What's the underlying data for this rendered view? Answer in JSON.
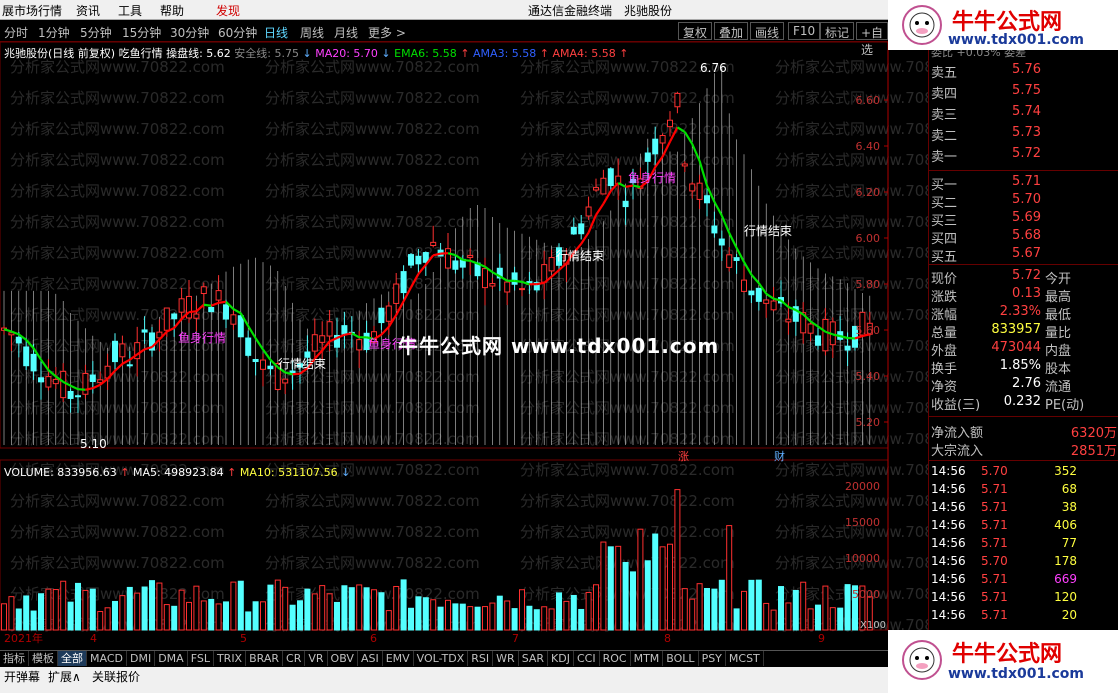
{
  "menu": {
    "items": [
      "展市场行情",
      "资讯",
      "工具",
      "帮助",
      "发现"
    ],
    "title": "通达信金融终端",
    "stock": "兆驰股份"
  },
  "periods": [
    "分时",
    "1分钟",
    "5分钟",
    "15分钟",
    "30分钟",
    "60分钟",
    "日线",
    "周线",
    "月线",
    "更多 >"
  ],
  "period_active": "日线",
  "toolbar_buttons": [
    "复权",
    "叠加",
    "画线",
    "F10",
    "标记",
    "+自选"
  ],
  "legend_main": {
    "name": "兆驰股份(日线 前复权) 吃鱼行情",
    "czx": "操盘线: 5.62",
    "aqx": "安全线: 5.75",
    "ma20": "MA20: 5.70",
    "ema6": "EMA6: 5.58",
    "ama3": "AMA3: 5.58",
    "ama4": "AMA4: 5.58"
  },
  "legend_volume": {
    "vol": "VOLUME: 833956.63",
    "ma5": "MA5: 498923.84",
    "ma10": "MA10: 531107.56"
  },
  "annotations": {
    "high": "6.76",
    "low": "5.10",
    "fish": "鱼身行情",
    "end": "行情结束",
    "year": "2021年",
    "up": "涨",
    "cai": "财",
    "x100": "X100"
  },
  "month_labels": [
    "4",
    "5",
    "6",
    "7",
    "8",
    "9"
  ],
  "price_axis": [
    "6.60",
    "6.40",
    "6.20",
    "6.00",
    "5.80",
    "5.60",
    "5.40",
    "5.20"
  ],
  "vol_axis": [
    "20000",
    "15000",
    "10000",
    "5000"
  ],
  "watermark": "分析家公式网www.70822.com",
  "overlay": "牛牛公式网 www.tdx001.com",
  "logo": {
    "cn": "牛牛公式网",
    "url": "www.tdx001.com"
  },
  "quote": {
    "header": "委比 +0.03% 委差",
    "sells": [
      {
        "label": "卖五",
        "price": "5.76"
      },
      {
        "label": "卖四",
        "price": "5.75"
      },
      {
        "label": "卖三",
        "price": "5.74"
      },
      {
        "label": "卖二",
        "price": "5.73"
      },
      {
        "label": "卖一",
        "price": "5.72"
      }
    ],
    "buys": [
      {
        "label": "买一",
        "price": "5.71"
      },
      {
        "label": "买二",
        "price": "5.70"
      },
      {
        "label": "买三",
        "price": "5.69"
      },
      {
        "label": "买四",
        "price": "5.68"
      },
      {
        "label": "买五",
        "price": "5.67"
      }
    ],
    "stats": [
      {
        "label": "现价",
        "value": "5.72",
        "right": "今开"
      },
      {
        "label": "涨跌",
        "value": "0.13",
        "right": "最高"
      },
      {
        "label": "涨幅",
        "value": "2.33%",
        "right": "最低"
      },
      {
        "label": "总量",
        "value": "833957",
        "right": "量比"
      },
      {
        "label": "外盘",
        "value": "473044",
        "right": "内盘"
      },
      {
        "label": "换手",
        "value": "1.85%",
        "right": "股本"
      },
      {
        "label": "净资",
        "value": "2.76",
        "right": "流通"
      },
      {
        "label": "收益(三)",
        "value": "0.232",
        "right": "PE(动)"
      }
    ],
    "flows": [
      {
        "label": "净流入额",
        "value": "6320万"
      },
      {
        "label": "大宗流入",
        "value": "2851万"
      }
    ],
    "ticks": [
      {
        "time": "14:56",
        "price": "5.70",
        "vol": "352"
      },
      {
        "time": "14:56",
        "price": "5.71",
        "vol": "68"
      },
      {
        "time": "14:56",
        "price": "5.71",
        "vol": "38"
      },
      {
        "time": "14:56",
        "price": "5.71",
        "vol": "406"
      },
      {
        "time": "14:56",
        "price": "5.71",
        "vol": "77"
      },
      {
        "time": "14:56",
        "price": "5.70",
        "vol": "178"
      },
      {
        "time": "14:56",
        "price": "5.71",
        "vol": "669"
      },
      {
        "time": "14:56",
        "price": "5.71",
        "vol": "120"
      },
      {
        "time": "14:56",
        "price": "5.71",
        "vol": "20"
      }
    ]
  },
  "indicator_tabs": [
    "指标",
    "模板",
    "全部",
    "MACD",
    "DMI",
    "DMA",
    "FSL",
    "TRIX",
    "BRAR",
    "CR",
    "VR",
    "OBV",
    "ASI",
    "EMV",
    "VOL-TDX",
    "RSI",
    "WR",
    "SAR",
    "KDJ",
    "CCI",
    "ROC",
    "MTM",
    "BOLL",
    "PSY",
    "MCST"
  ],
  "indicator_active": "全部",
  "status_items": [
    "开弹幕",
    "扩展∧",
    "关联报价"
  ],
  "colors": {
    "up": "#ff3030",
    "down": "#54ffff",
    "ema": "#00e000",
    "red_line": "#ff0000",
    "axis": "#b00000"
  }
}
